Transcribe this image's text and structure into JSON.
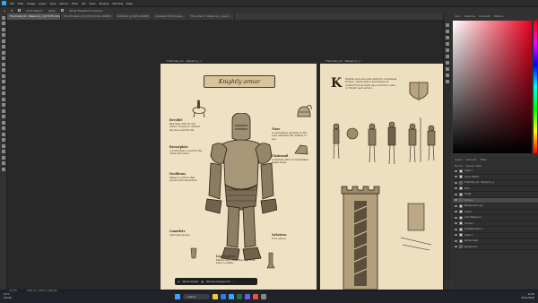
{
  "menubar": {
    "items": [
      "File",
      "Edit",
      "Image",
      "Layer",
      "Type",
      "Select",
      "Filter",
      "3D",
      "View",
      "Plugins",
      "Window",
      "Help"
    ]
  },
  "optionsbar": {
    "auto_select_label": "Auto-Select:",
    "auto_select_value": "Layer",
    "show_transform_label": "Show Transform Controls"
  },
  "tabs": [
    {
      "label": "The Codex_01 - Weaponry_1 @ 33.3% (Color, CMYK/8#)",
      "active": true
    },
    {
      "label": "The Ultimate Lit @ 33.6% (Color, RGB/8)",
      "active": false
    },
    {
      "label": "Untitled-1 @ 100% (RGB/8)",
      "active": false
    },
    {
      "label": "A detailed 3D full page…",
      "active": false
    },
    {
      "label": "The codex 2 - Weaponry - Layout…",
      "active": false
    }
  ],
  "artboards": {
    "left_label": "TheCodex_01 - Weaponry_1",
    "right_label": "TheCodex_01 - Weaponry_1"
  },
  "left_page": {
    "banner": "Knightly armor",
    "captions": [
      {
        "title": "Bevoliet",
        "text": "Bevolied with its the armor chosen to defend the face and throat."
      },
      {
        "title": "Visor",
        "text": "A perforated opening at the eyes allowing the wearer to see."
      },
      {
        "title": "Breastplate",
        "text": "A solid plate covering the chest and torso."
      },
      {
        "title": "Chainmail",
        "text": "A flexible shirt of interlinked metal rings."
      },
      {
        "title": "Pauldrons",
        "text": "Plates of armor that protect the shoulders."
      },
      {
        "title": "Gauntlets",
        "text": "Armored gloves."
      },
      {
        "title": "Sabatons",
        "text": "Foot armor."
      },
      {
        "title": "Leg Greaves",
        "text": "Plates that cover the legs from knee to ankle."
      }
    ]
  },
  "right_page": {
    "drop_cap": "K",
    "intro": "Knights were the elite warriors of medieval Europe, clad in armor and trained in combat from an early age, bound by codes of chivalry and service."
  },
  "context_bar": {
    "select_subject": "Select subject",
    "remove_background": "Remove background"
  },
  "right_panels": {
    "top_tabs": [
      "Color",
      "Swatches",
      "Gradients",
      "Patterns"
    ],
    "layers_tabs": [
      "Layers",
      "Channels",
      "Paths"
    ],
    "blend_mode": "Normal",
    "opacity": "Opacity: 100%",
    "layers": [
      {
        "name": "Layer 1",
        "selected": false,
        "dark": false
      },
      {
        "name": "Armor Sketch",
        "selected": false,
        "dark": false
      },
      {
        "name": "TheCodex_01 - Weaponry_1",
        "selected": false,
        "dark": true
      },
      {
        "name": "Text",
        "selected": false,
        "dark": false
      },
      {
        "name": "Image",
        "selected": false,
        "dark": false
      },
      {
        "name": "Group 1",
        "selected": true,
        "dark": true
      },
      {
        "name": "Background copy",
        "selected": false,
        "dark": false
      },
      {
        "name": "Level 1",
        "selected": false,
        "dark": false
      },
      {
        "name": "Color Balance 1",
        "selected": false,
        "dark": false
      },
      {
        "name": "Curves 1",
        "selected": false,
        "dark": false
      },
      {
        "name": "Hue/Saturation 1",
        "selected": false,
        "dark": false
      },
      {
        "name": "Layer 2",
        "selected": false,
        "dark": false
      },
      {
        "name": "texture base",
        "selected": false,
        "dark": false
      },
      {
        "name": "Background",
        "selected": false,
        "dark": true
      }
    ]
  },
  "status": {
    "zoom": "33.33%",
    "doc_size": "2550 px x 3300 px (300 ppi)"
  },
  "taskbar": {
    "weather_temp": "14°C",
    "weather_desc": "Cloudy",
    "search": "Search",
    "time": "12:43",
    "date": "30/11/2024"
  },
  "colors": {
    "ps_blue": "#31a8ff",
    "page_bg": "#efe2c4",
    "ink": "#3a2a1a"
  }
}
